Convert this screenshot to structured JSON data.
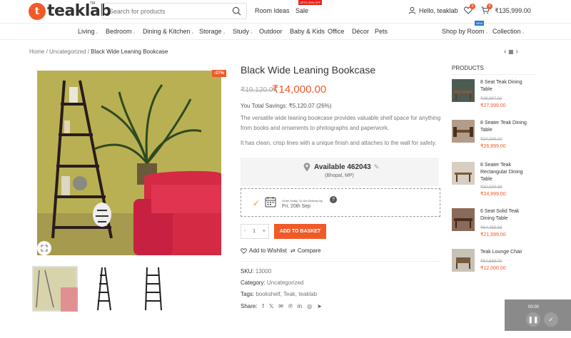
{
  "brand": {
    "logo_letter": "t",
    "name": "teaklab",
    "tm": "TM"
  },
  "header": {
    "search_placeholder": "Search for products",
    "room_ideas": "Room Ideas",
    "sale": "Sale",
    "sale_badge": "UPTO 30% OFF",
    "greeting": "Hello, teaklab",
    "wishlist_count": "0",
    "cart_count": "0",
    "cart_total": "₹135,999.00"
  },
  "nav": {
    "items": [
      "Living",
      "Bedroom",
      "Dining & Kitchen",
      "Storage",
      "Study",
      "Outdoor",
      "Baby & Kids",
      "Office",
      "Décor",
      "Pets"
    ],
    "shop_by_room": "Shop by Room",
    "collection": "Collection",
    "new_badge": "NEW"
  },
  "breadcrumb": {
    "home": "Home",
    "category": "Uncategorized",
    "current": "Black Wide Leaning Bookcase"
  },
  "product": {
    "title": "Black Wide Leaning Bookcase",
    "old_price": "₹19,120.07",
    "new_price": "₹14,000.00",
    "discount_badge": "-27%",
    "savings_label": "You Total Savings:",
    "savings_value": "₹5,120.07 (26%)",
    "desc1": "The versatile wide leaning bookcase provides valuable shelf space for anything from books and ornaments to photographs and paperwork.",
    "desc2": "It has clean, crisp lines with a unique finish and attaches to the wall for safety.",
    "available_label": "Available 462043",
    "available_city": "(Bhopal, MP)",
    "delivery_small": "Order Today, To Get Delivery By",
    "delivery_date": "Fri, 20th Sep",
    "qty": "1",
    "qty_minus": "-",
    "qty_plus": "+",
    "add_to_basket": "ADD TO BASKET",
    "add_wishlist": "Add to Wishlist",
    "compare": "Compare",
    "sku_label": "SKU:",
    "sku": "13000",
    "category_label": "Category:",
    "category": "Uncategorized",
    "tags_label": "Tags:",
    "tags": "bookshelf, Teak, teaklab",
    "share_label": "Share:",
    "share_icons": [
      "f",
      "x",
      "mail",
      "pinterest",
      "linkedin",
      "whatsapp",
      "telegram"
    ]
  },
  "sidebar": {
    "title": "PRODUCTS",
    "items": [
      {
        "name": "8 Seat Teak Dining Table",
        "old": "₹36,997.00",
        "new": "₹27,999.00"
      },
      {
        "name": "8 Seater Teak Dining Table",
        "old": "₹34,099.00",
        "new": "₹26,999.00"
      },
      {
        "name": "8 Seater Teak Rectangular Dining Table",
        "old": "₹32,939.39",
        "new": "₹24,999.00"
      },
      {
        "name": "6 Seat Solid Teak Dining Table",
        "old": "₹64,459.58",
        "new": "₹21,999.00"
      },
      {
        "name": "Teak Lounge Chair",
        "old": "₹54,668.00",
        "new": "₹12,000.00"
      }
    ]
  },
  "video": {
    "time": "00:00"
  },
  "colors": {
    "accent": "#f05a28",
    "wall": "#b9b054",
    "sofa": "#d42a44"
  }
}
